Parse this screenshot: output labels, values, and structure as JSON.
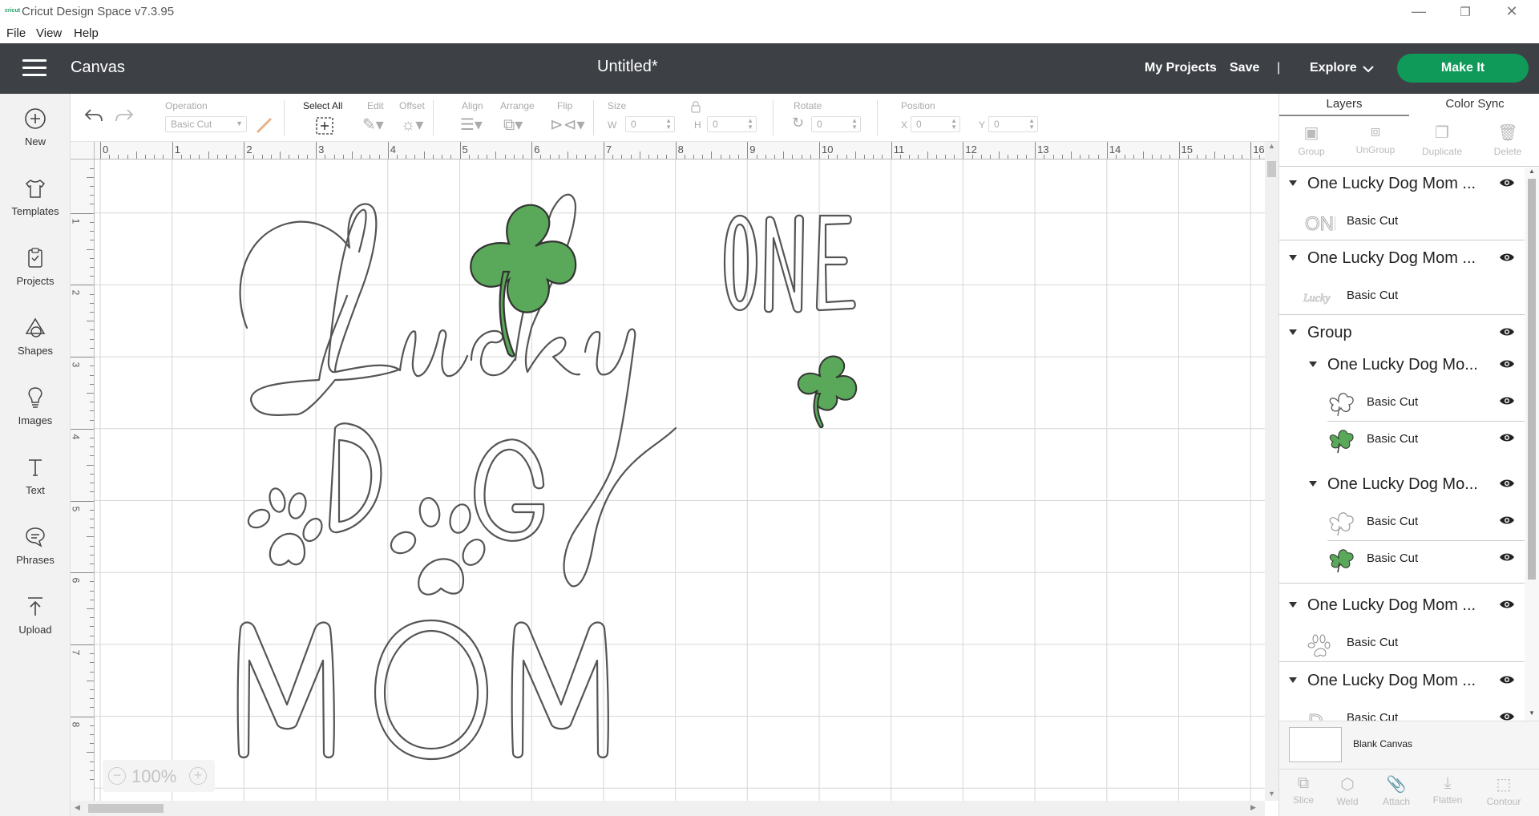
{
  "window": {
    "title": "Cricut Design Space  v7.3.95",
    "logo": "cricut",
    "minimize": "—",
    "maximize": "❐",
    "close": "✕"
  },
  "menu": [
    "File",
    "View",
    "Help"
  ],
  "header": {
    "section": "Canvas",
    "document_title": "Untitled*",
    "my_projects": "My Projects",
    "save": "Save",
    "separator": "|",
    "explore": "Explore",
    "make_it": "Make It"
  },
  "left_tools": [
    {
      "label": "New",
      "icon": "plus-circle-icon"
    },
    {
      "label": "Templates",
      "icon": "shirt-icon"
    },
    {
      "label": "Projects",
      "icon": "clipboard-icon"
    },
    {
      "label": "Shapes",
      "icon": "shapes-icon"
    },
    {
      "label": "Images",
      "icon": "lightbulb-icon"
    },
    {
      "label": "Text",
      "icon": "text-icon"
    },
    {
      "label": "Phrases",
      "icon": "speech-bubble-icon"
    },
    {
      "label": "Upload",
      "icon": "upload-icon"
    }
  ],
  "edit_toolbar": {
    "operation_label": "Operation",
    "operation_value": "Basic Cut",
    "select_all": "Select All",
    "edit": "Edit",
    "offset": "Offset",
    "align": "Align",
    "arrange": "Arrange",
    "flip": "Flip",
    "size": "Size",
    "w_label": "W",
    "w_value": "0",
    "h_label": "H",
    "h_value": "0",
    "rotate": "Rotate",
    "rotate_value": "0",
    "position": "Position",
    "x_label": "X",
    "x_value": "0",
    "y_label": "Y",
    "y_value": "0"
  },
  "ruler": {
    "top_ticks": [
      "0",
      "1",
      "2",
      "3",
      "4",
      "5",
      "6",
      "7",
      "8",
      "9",
      "10",
      "11",
      "12",
      "13",
      "14",
      "15",
      "16"
    ],
    "left_ticks": [
      "0",
      "1",
      "2",
      "3",
      "4",
      "5",
      "6",
      "7",
      "8"
    ]
  },
  "zoom": {
    "value": "100%",
    "minus": "−",
    "plus": "+"
  },
  "right_panel": {
    "tabs": [
      "Layers",
      "Color Sync"
    ],
    "actions": [
      "Group",
      "UnGroup",
      "Duplicate",
      "Delete"
    ],
    "layers": [
      {
        "name": "One Lucky Dog Mom ...",
        "op": "Basic Cut",
        "thumb": "ONE"
      },
      {
        "name": "One Lucky Dog Mom ...",
        "op": "Basic Cut",
        "thumb": "Lucky"
      },
      {
        "name": "Group"
      },
      {
        "name": "One Lucky Dog Mo...",
        "children": [
          {
            "op": "Basic Cut",
            "thumb": "clover-outline"
          },
          {
            "op": "Basic Cut",
            "thumb": "clover-green"
          }
        ]
      },
      {
        "name": "One Lucky Dog Mo...",
        "children": [
          {
            "op": "Basic Cut",
            "thumb": "clover-outline"
          },
          {
            "op": "Basic Cut",
            "thumb": "clover-green"
          }
        ]
      },
      {
        "name": "One Lucky Dog Mom ...",
        "op": "Basic Cut",
        "thumb": "paw"
      },
      {
        "name": "One Lucky Dog Mom ...",
        "op": "Basic Cut",
        "thumb": "D"
      }
    ],
    "blank_canvas": "Blank Canvas",
    "bottom_tools": [
      "Slice",
      "Weld",
      "Attach",
      "Flatten",
      "Contour"
    ]
  },
  "design": {
    "words": [
      "ONE",
      "Lucky",
      "DOG",
      "MOM"
    ],
    "clover_color": "#5aa85a",
    "stroke_color": "#555555"
  },
  "colors": {
    "header": "#3d4146",
    "make_it": "#0f9a5a"
  }
}
